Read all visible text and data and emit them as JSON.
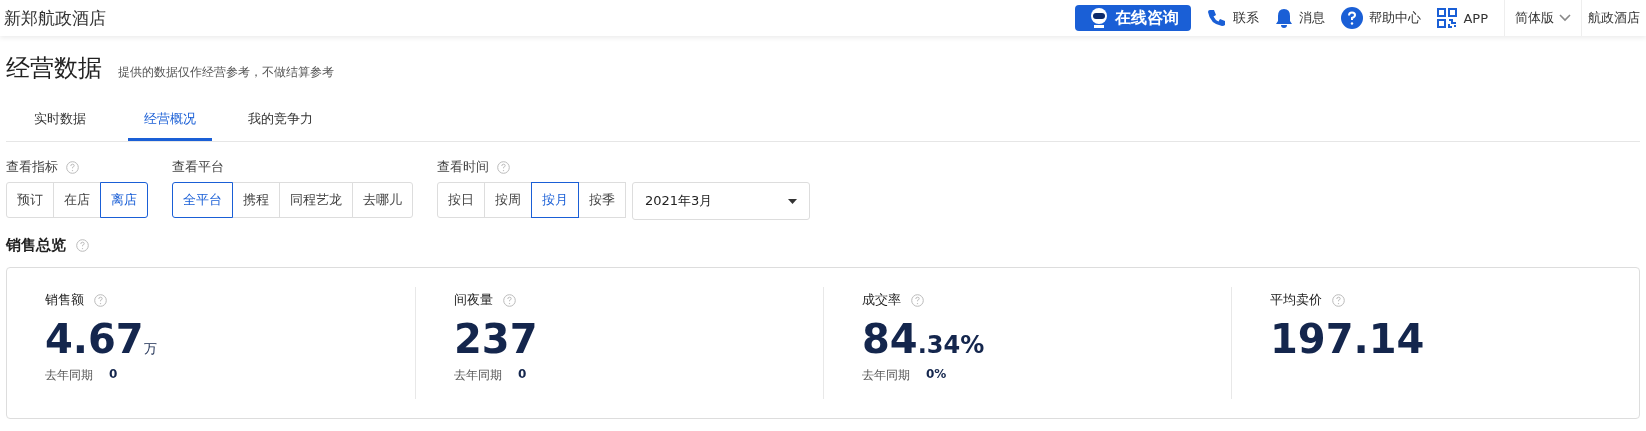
{
  "header": {
    "hotel_name": "新郑航政酒店",
    "consult_button": "在线咨询",
    "links": [
      {
        "kind": "phone",
        "label": "联系"
      },
      {
        "kind": "bell",
        "label": "消息"
      },
      {
        "kind": "help",
        "label": "帮助中心"
      },
      {
        "kind": "qr",
        "label": "APP"
      }
    ],
    "version_menu": "简体版",
    "account": "航政酒店"
  },
  "page": {
    "title": "经营数据",
    "subtitle": "提供的数据仅作经营参考，不做结算参考"
  },
  "tabs": [
    {
      "label": "实时数据",
      "selected": false
    },
    {
      "label": "经营概况",
      "selected": true
    },
    {
      "label": "我的竞争力",
      "selected": false
    }
  ],
  "filters": [
    {
      "label": "查看指标",
      "help": true,
      "options": [
        {
          "label": "预订",
          "selected": false
        },
        {
          "label": "在店",
          "selected": false
        },
        {
          "label": "离店",
          "selected": true
        }
      ]
    },
    {
      "label": "查看平台",
      "help": false,
      "options": [
        {
          "label": "全平台",
          "selected": true
        },
        {
          "label": "携程",
          "selected": false
        },
        {
          "label": "同程艺龙",
          "selected": false
        },
        {
          "label": "去哪儿",
          "selected": false
        }
      ]
    },
    {
      "label": "查看时间",
      "help": true,
      "options": [
        {
          "label": "按日",
          "selected": false
        },
        {
          "label": "按周",
          "selected": false
        },
        {
          "label": "按月",
          "selected": true
        },
        {
          "label": "按季",
          "selected": false
        }
      ],
      "dropdown": "2021年3月"
    }
  ],
  "sales_overview": {
    "title": "销售总览",
    "metrics": [
      {
        "label": "销售额",
        "value": "4.67",
        "suffix": "万",
        "compare_label": "去年同期",
        "compare_value": "0"
      },
      {
        "label": "间夜量",
        "value": "237",
        "compare_label": "去年同期",
        "compare_value": "0"
      },
      {
        "label": "成交率",
        "value": "84",
        "suffix": ".34%",
        "compare_label": "去年同期",
        "compare_value": "0%"
      },
      {
        "label": "平均卖价",
        "value": "197.14"
      }
    ]
  }
}
